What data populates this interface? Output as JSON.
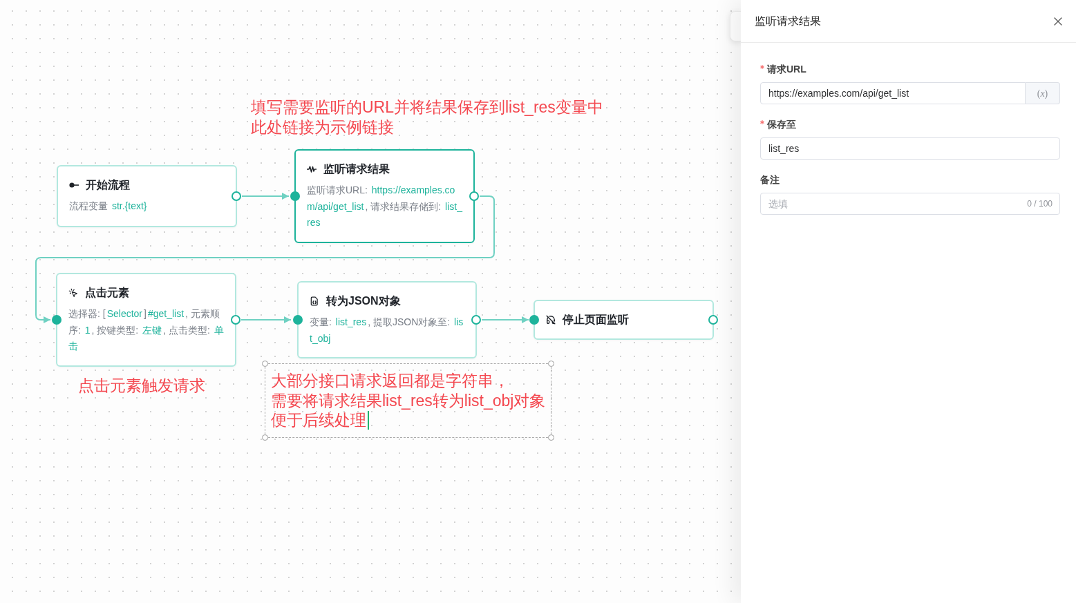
{
  "canvas": {
    "nodes": [
      {
        "kind": "start",
        "title": "开始流程",
        "body": "流程变量 **str.{text}**",
        "selected": false
      },
      {
        "kind": "listen",
        "title": "监听请求结果",
        "body": "监听请求URL: **https://examples.com/api/get_list**, 请求结果存储到: **list_res**",
        "selected": true
      },
      {
        "kind": "click",
        "title": "点击元素",
        "body": "选择器: [**Selector**]**#get_list**, 元素顺序: **1**, 按键类型: **左键**, 点击类型: **单击**",
        "selected": false
      },
      {
        "kind": "to_json",
        "title": "转为JSON对象",
        "body": "变量: **list_res**, 提取JSON对象至: **list_obj**",
        "selected": false
      },
      {
        "kind": "stop_listen",
        "title": "停止页面监听",
        "selected": false
      }
    ],
    "annotations": [
      {
        "lines": [
          "填写需要监听的URL并将结果保存到list_res变量中",
          "此处链接为示例链接"
        ],
        "selected": false
      },
      {
        "lines": [
          "点击元素触发请求"
        ],
        "selected": false
      },
      {
        "lines": [
          "大部分接口请求返回都是字符串，",
          "需要将请求结果list_res转为list_obj对象",
          "便于后续处理"
        ],
        "selected": true
      }
    ]
  },
  "panel": {
    "title": "监听请求结果",
    "fields": [
      {
        "kind": "variable_input",
        "label": "请求URL",
        "required": true,
        "value": "https://examples.com/api/get_list",
        "addon": "(*x*)"
      },
      {
        "kind": "input",
        "label": "保存至",
        "required": true,
        "value": "list_res"
      },
      {
        "kind": "counted_input",
        "label": "备注",
        "required": false,
        "placeholder": "选填",
        "counter": "0 / 100"
      }
    ]
  }
}
